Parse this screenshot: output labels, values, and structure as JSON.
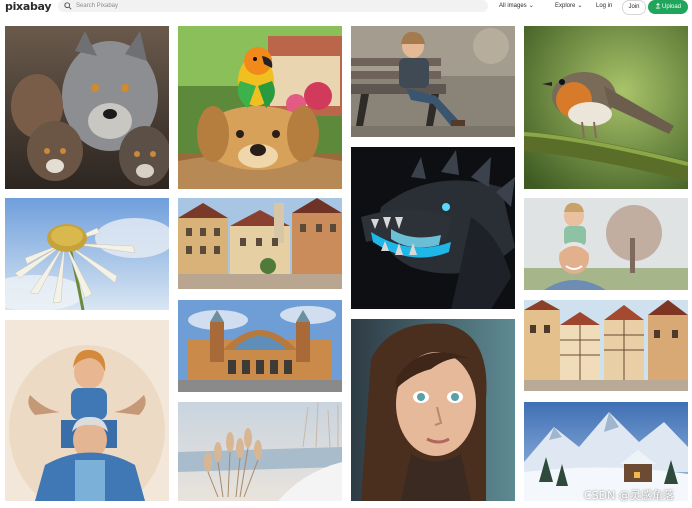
{
  "header": {
    "logo": "pixabay",
    "search_placeholder": "Search Pixabay",
    "nav": {
      "all_images": "All images",
      "explore": "Explore",
      "login": "Log in",
      "join": "Join",
      "upload": "Upload"
    }
  },
  "watermark": "CSDN @灵感角落",
  "gallery": [
    {
      "subject": "wolves"
    },
    {
      "subject": "parrot-on-dog"
    },
    {
      "subject": "child-on-bench"
    },
    {
      "subject": "robin"
    },
    {
      "subject": "daisy"
    },
    {
      "subject": "dragon"
    },
    {
      "subject": "old-town-street"
    },
    {
      "subject": "grandfather-and-child"
    },
    {
      "subject": "railway-station"
    },
    {
      "subject": "grandmother-and-child"
    },
    {
      "subject": "girl-portrait"
    },
    {
      "subject": "half-timbered-village"
    },
    {
      "subject": "winter-reeds"
    },
    {
      "subject": "snowy-mountain-village"
    }
  ]
}
